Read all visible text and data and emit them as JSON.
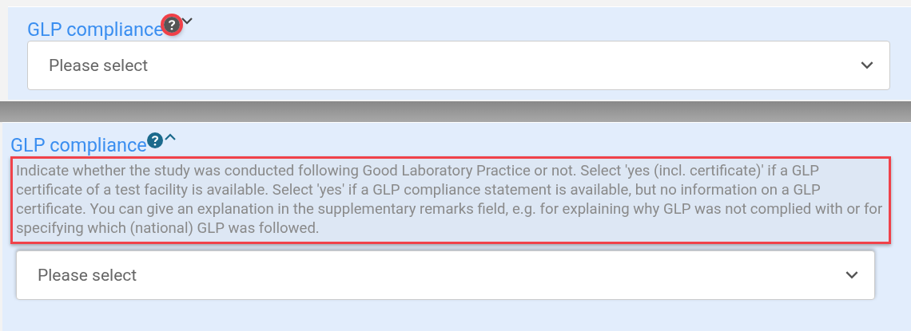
{
  "panels": [
    {
      "label": "GLP compliance",
      "expanded": false,
      "help_highlighted": true,
      "select": {
        "placeholder": "Please select"
      }
    },
    {
      "label": "GLP compliance",
      "expanded": true,
      "help_highlighted": false,
      "help_text": "Indicate whether the study was conducted following Good Laboratory Practice or not. Select 'yes (incl. certificate)' if a GLP certificate of a test facility is available. Select 'yes' if a GLP compliance statement is available, but no information on a GLP certificate. You can give an explanation in the supplementary remarks field, e.g. for explaining why GLP was not complied with or for specifying which (national) GLP was followed.",
      "help_text_highlighted": true,
      "select": {
        "placeholder": "Please select"
      }
    }
  ]
}
